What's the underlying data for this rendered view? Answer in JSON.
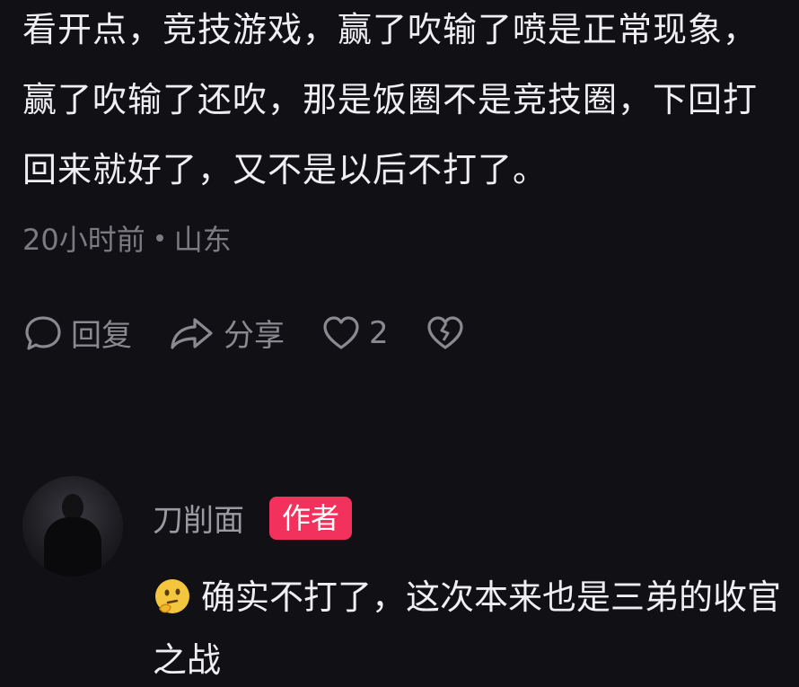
{
  "comment": {
    "text": "看开点，竞技游戏，赢了吹输了喷是正常现象，赢了吹输了还吹，那是饭圈不是竞技圈，下回打回来就好了，又不是以后不打了。",
    "time": "20小时前",
    "location": "山东"
  },
  "actions": {
    "reply_label": "回复",
    "share_label": "分享",
    "like_count": "2"
  },
  "reply": {
    "name": "刀削面",
    "badge": "作者",
    "text": "确实不打了，这次本来也是三弟的收官之战",
    "emoji_icon": "thinking-face-icon"
  },
  "colors": {
    "background": "#111014",
    "badge": "#f2315c",
    "muted": "#7c7b82"
  }
}
